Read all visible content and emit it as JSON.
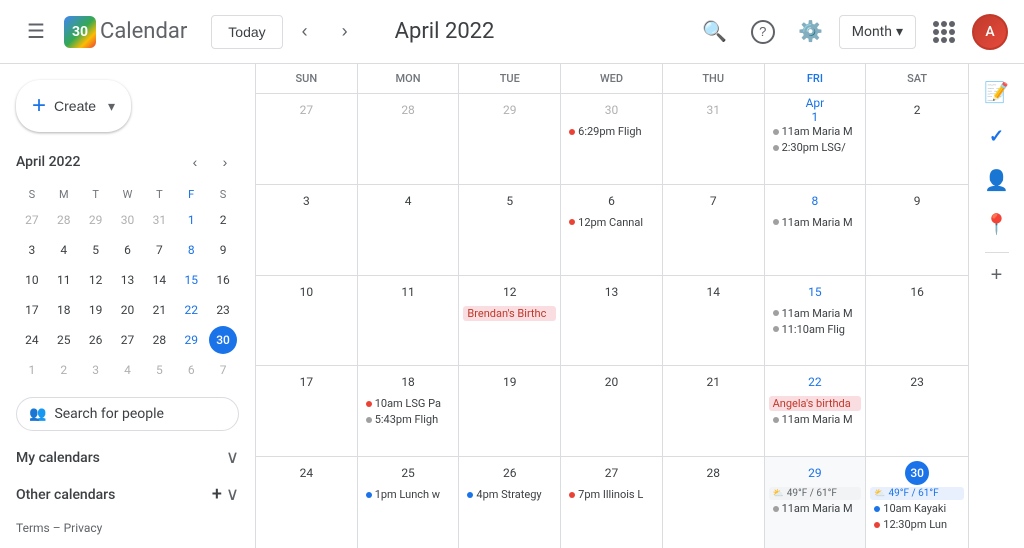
{
  "header": {
    "menu_icon": "☰",
    "logo_text": "Calendar",
    "logo_number": "30",
    "today_label": "Today",
    "nav_prev": "‹",
    "nav_next": "›",
    "title": "April 2022",
    "search_icon": "🔍",
    "help_icon": "?",
    "settings_icon": "⚙",
    "view_label": "Month",
    "view_arrow": "▾",
    "apps_icon": "⋮⋮⋮",
    "avatar_text": "A"
  },
  "sidebar": {
    "create_label": "Create",
    "mini_cal": {
      "title": "April 2022",
      "nav_prev": "‹",
      "nav_next": "›",
      "day_headers": [
        "S",
        "M",
        "T",
        "W",
        "T",
        "F",
        "S"
      ],
      "weeks": [
        [
          {
            "n": "27",
            "om": true
          },
          {
            "n": "28",
            "om": true
          },
          {
            "n": "29",
            "om": true
          },
          {
            "n": "30",
            "om": true
          },
          {
            "n": "31",
            "om": true
          },
          {
            "n": "1",
            "fri": true
          },
          {
            "n": "2"
          }
        ],
        [
          {
            "n": "3"
          },
          {
            "n": "4"
          },
          {
            "n": "5"
          },
          {
            "n": "6"
          },
          {
            "n": "7"
          },
          {
            "n": "8"
          },
          {
            "n": "9"
          }
        ],
        [
          {
            "n": "10"
          },
          {
            "n": "11"
          },
          {
            "n": "12"
          },
          {
            "n": "13"
          },
          {
            "n": "14"
          },
          {
            "n": "15"
          },
          {
            "n": "16"
          }
        ],
        [
          {
            "n": "17"
          },
          {
            "n": "18"
          },
          {
            "n": "19"
          },
          {
            "n": "20"
          },
          {
            "n": "21"
          },
          {
            "n": "22"
          },
          {
            "n": "23"
          }
        ],
        [
          {
            "n": "24"
          },
          {
            "n": "25"
          },
          {
            "n": "26"
          },
          {
            "n": "27"
          },
          {
            "n": "28"
          },
          {
            "n": "29",
            "fri": true
          },
          {
            "n": "30",
            "today": true
          }
        ],
        [
          {
            "n": "1",
            "om": true
          },
          {
            "n": "2",
            "om": true
          },
          {
            "n": "3",
            "om": true
          },
          {
            "n": "4",
            "om": true
          },
          {
            "n": "5",
            "om": true
          },
          {
            "n": "6",
            "om": true
          },
          {
            "n": "7",
            "om": true
          }
        ]
      ]
    },
    "search_people": "Search for people",
    "my_calendars": "My calendars",
    "other_calendars": "Other calendars",
    "terms_text": "Terms",
    "privacy_text": "Privacy"
  },
  "calendar": {
    "day_headers": [
      {
        "label": "SUN",
        "blue": false
      },
      {
        "label": "MON",
        "blue": false
      },
      {
        "label": "TUE",
        "blue": false
      },
      {
        "label": "WED",
        "blue": false
      },
      {
        "label": "THU",
        "blue": false
      },
      {
        "label": "FRI",
        "blue": true
      },
      {
        "label": "SAT",
        "blue": false
      }
    ],
    "weeks": [
      {
        "cells": [
          {
            "date": "27",
            "om": true,
            "events": []
          },
          {
            "date": "28",
            "om": true,
            "events": []
          },
          {
            "date": "29",
            "om": true,
            "events": []
          },
          {
            "date": "30",
            "om": true,
            "events": [
              {
                "text": "6:29pm Fligh",
                "type": "dot",
                "dot_color": "#ea4335",
                "style": "none"
              }
            ]
          },
          {
            "date": "31",
            "om": true,
            "events": []
          },
          {
            "date": "Apr 1",
            "fri": true,
            "events": [
              {
                "text": "11am Maria M",
                "type": "dot",
                "dot_color": "#a0a0a0",
                "style": "none"
              },
              {
                "text": "2:30pm LSG/",
                "type": "dot",
                "dot_color": "#a0a0a0",
                "style": "none"
              }
            ]
          },
          {
            "date": "2",
            "events": []
          }
        ]
      },
      {
        "cells": [
          {
            "date": "3",
            "events": []
          },
          {
            "date": "4",
            "events": []
          },
          {
            "date": "5",
            "events": []
          },
          {
            "date": "6",
            "events": [
              {
                "text": "12pm Cannal",
                "type": "dot",
                "dot_color": "#ea4335",
                "style": "none"
              }
            ]
          },
          {
            "date": "7",
            "events": []
          },
          {
            "date": "8",
            "fri": true,
            "events": [
              {
                "text": "11am Maria M",
                "type": "dot",
                "dot_color": "#a0a0a0",
                "style": "none"
              }
            ]
          },
          {
            "date": "9",
            "events": []
          }
        ]
      },
      {
        "cells": [
          {
            "date": "10",
            "events": []
          },
          {
            "date": "11",
            "events": []
          },
          {
            "date": "12",
            "events": [
              {
                "text": "Brendan's Birthc",
                "type": "bg",
                "style": "pink-bg"
              }
            ]
          },
          {
            "date": "13",
            "events": []
          },
          {
            "date": "14",
            "events": []
          },
          {
            "date": "15",
            "fri": true,
            "events": [
              {
                "text": "11am Maria M",
                "type": "dot",
                "dot_color": "#a0a0a0",
                "style": "none"
              },
              {
                "text": "11:10am Flig",
                "type": "dot",
                "dot_color": "#a0a0a0",
                "style": "none"
              }
            ]
          },
          {
            "date": "16",
            "events": []
          }
        ]
      },
      {
        "cells": [
          {
            "date": "17",
            "events": []
          },
          {
            "date": "18",
            "events": [
              {
                "text": "10am LSG Pa",
                "type": "dot",
                "dot_color": "#ea4335",
                "style": "none"
              },
              {
                "text": "5:43pm Fligh",
                "type": "dot",
                "dot_color": "#a0a0a0",
                "style": "none"
              }
            ]
          },
          {
            "date": "19",
            "events": []
          },
          {
            "date": "20",
            "events": []
          },
          {
            "date": "21",
            "events": []
          },
          {
            "date": "22",
            "fri": true,
            "events": [
              {
                "text": "Angela's birthda",
                "type": "bg",
                "style": "pink-bg"
              },
              {
                "text": "11am Maria M",
                "type": "dot",
                "dot_color": "#a0a0a0",
                "style": "none"
              }
            ]
          },
          {
            "date": "23",
            "events": []
          }
        ]
      },
      {
        "cells": [
          {
            "date": "24",
            "events": []
          },
          {
            "date": "25",
            "events": [
              {
                "text": "1pm Lunch w",
                "type": "dot",
                "dot_color": "#1a73e8",
                "style": "none"
              }
            ]
          },
          {
            "date": "26",
            "events": [
              {
                "text": "4pm Strategy",
                "type": "dot",
                "dot_color": "#1a73e8",
                "style": "none"
              }
            ]
          },
          {
            "date": "27",
            "events": [
              {
                "text": "7pm Illinois L",
                "type": "dot",
                "dot_color": "#ea4335",
                "style": "none"
              }
            ]
          },
          {
            "date": "28",
            "events": []
          },
          {
            "date": "29",
            "fri": true,
            "events": [
              {
                "text": "49°F / 61°F",
                "type": "weather",
                "style": "weather-gray"
              },
              {
                "text": "11am Maria M",
                "type": "dot",
                "dot_color": "#a0a0a0",
                "style": "none"
              }
            ]
          },
          {
            "date": "30",
            "today": true,
            "events": [
              {
                "text": "49°F / 61°F",
                "type": "weather",
                "style": "weather-blue"
              },
              {
                "text": "10am Kayaki",
                "type": "dot",
                "dot_color": "#1a73e8",
                "style": "none"
              },
              {
                "text": "12:30pm Lun",
                "type": "dot",
                "dot_color": "#ea4335",
                "style": "none"
              }
            ]
          }
        ]
      }
    ]
  },
  "right_sidebar": {
    "keep_icon": "📝",
    "tasks_icon": "✓",
    "contacts_icon": "👤",
    "maps_icon": "📍"
  }
}
